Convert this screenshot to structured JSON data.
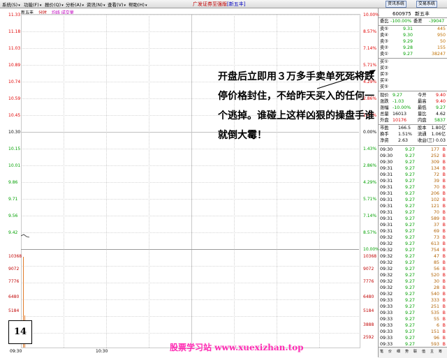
{
  "menu": [
    "系统(S)",
    "功能(F)",
    "报价(Q)",
    "分析(A)",
    "资讯(N)",
    "查看(V)",
    "帮助(H)"
  ],
  "app_title": "广发证券至强版",
  "app_title_sub": "[新五丰]",
  "toolbar_buttons": [
    "资讯系统",
    "交易系统"
  ],
  "chart_tabs": {
    "name": "新五丰",
    "time": "分时",
    "avg": "均线 成交量"
  },
  "price_axis": [
    "11.33",
    "11.18",
    "11.03",
    "10.89",
    "10.74",
    "10.59",
    "10.45",
    "10.30",
    "10.15",
    "10.01",
    "9.86",
    "9.71",
    "9.56",
    "9.42"
  ],
  "pct_axis_up": [
    "10.00%",
    "8.57%",
    "7.14%",
    "5.71%",
    "4.29%",
    "2.86%",
    "1.43%",
    "0.00%"
  ],
  "pct_axis_down": [
    "1.43%",
    "2.86%",
    "4.29%",
    "5.71%",
    "7.14%",
    "8.57%",
    "10.00%"
  ],
  "volume_axis": [
    "10368",
    "9072",
    "7776",
    "6480",
    "5184",
    "3888",
    "2592",
    "1296"
  ],
  "time_labels": [
    "09:30",
    "10:30"
  ],
  "badge": "14",
  "annotation": "开盘后立即用３万多手卖单死死将跌停价格封住，不给昨天买入的任何一个逃掉。谁碰上这样凶狠的操盘手谁就倒大霉！",
  "watermark": "股票学习站   www.xuexizhan.top",
  "stock": {
    "code": "600975",
    "name": "新五丰"
  },
  "commission": {
    "label": "委比",
    "ratio": "-100.00%",
    "diff_label": "委差",
    "diff": "-39047"
  },
  "sell_orders": [
    {
      "label": "卖⑤",
      "price": "9.31",
      "vol": "445"
    },
    {
      "label": "卖④",
      "price": "9.30",
      "vol": "950"
    },
    {
      "label": "卖③",
      "price": "9.29",
      "vol": "50"
    },
    {
      "label": "卖②",
      "price": "9.28",
      "vol": "155"
    },
    {
      "label": "卖①",
      "price": "9.27",
      "vol": "38247"
    }
  ],
  "buy_orders": [
    "买①",
    "买②",
    "买③",
    "买④",
    "买⑤"
  ],
  "quote_rows": [
    {
      "l1": "现价",
      "v1": "9.27",
      "l2": "今开",
      "v2": "9.40"
    },
    {
      "l1": "涨跌",
      "v1": "-1.03",
      "l2": "最高",
      "v2": "9.40"
    },
    {
      "l1": "涨幅",
      "v1": "-10.00%",
      "l2": "最低",
      "v2": "9.27"
    },
    {
      "l1": "总量",
      "v1": "16013",
      "l2": "量比",
      "v2": "4.62"
    },
    {
      "l1": "外盘",
      "v1": "10176",
      "l2": "内盘",
      "v2": "5837"
    }
  ],
  "stats_rows": [
    {
      "l1": "市盈",
      "v1": "166.5",
      "l2": "股本",
      "v2": "1.80亿"
    },
    {
      "l1": "换手",
      "v1": "1.51%",
      "l2": "流通",
      "v2": "1.06亿"
    },
    {
      "l1": "净资",
      "v1": "2.63",
      "l2": "收益(三)",
      "v2": "0.03"
    }
  ],
  "ticks": [
    {
      "t": "09:30",
      "p": "9.27",
      "v": "177",
      "d": "B"
    },
    {
      "t": "09:30",
      "p": "9.27",
      "v": "252",
      "d": "B"
    },
    {
      "t": "09:30",
      "p": "9.27",
      "v": "309",
      "d": "B"
    },
    {
      "t": "09:31",
      "p": "9.27",
      "v": "134",
      "d": "B"
    },
    {
      "t": "09:31",
      "p": "9.27",
      "v": "72",
      "d": "B"
    },
    {
      "t": "09:31",
      "p": "9.27",
      "v": "39",
      "d": "B"
    },
    {
      "t": "09:31",
      "p": "9.27",
      "v": "70",
      "d": "B"
    },
    {
      "t": "09:31",
      "p": "9.27",
      "v": "206",
      "d": "B"
    },
    {
      "t": "09:31",
      "p": "9.27",
      "v": "102",
      "d": "B"
    },
    {
      "t": "09:31",
      "p": "9.27",
      "v": "121",
      "d": "B"
    },
    {
      "t": "09:31",
      "p": "9.27",
      "v": "70",
      "d": "B"
    },
    {
      "t": "09:31",
      "p": "9.27",
      "v": "589",
      "d": "B"
    },
    {
      "t": "09:31",
      "p": "9.27",
      "v": "37",
      "d": "B"
    },
    {
      "t": "09:31",
      "p": "9.27",
      "v": "69",
      "d": "B"
    },
    {
      "t": "09:32",
      "p": "9.27",
      "v": "73",
      "d": "B"
    },
    {
      "t": "09:32",
      "p": "9.27",
      "v": "613",
      "d": "B"
    },
    {
      "t": "09:32",
      "p": "9.27",
      "v": "754",
      "d": "B"
    },
    {
      "t": "09:32",
      "p": "9.27",
      "v": "47",
      "d": "B"
    },
    {
      "t": "09:32",
      "p": "9.27",
      "v": "85",
      "d": "B"
    },
    {
      "t": "09:32",
      "p": "9.27",
      "v": "56",
      "d": "B"
    },
    {
      "t": "09:32",
      "p": "9.27",
      "v": "520",
      "d": "B"
    },
    {
      "t": "09:32",
      "p": "9.27",
      "v": "30",
      "d": "B"
    },
    {
      "t": "09:32",
      "p": "9.27",
      "v": "28",
      "d": "B"
    },
    {
      "t": "09:32",
      "p": "9.27",
      "v": "540",
      "d": "B"
    },
    {
      "t": "09:33",
      "p": "9.27",
      "v": "333",
      "d": "B"
    },
    {
      "t": "09:33",
      "p": "9.27",
      "v": "251",
      "d": "B"
    },
    {
      "t": "09:33",
      "p": "9.27",
      "v": "535",
      "d": "B"
    },
    {
      "t": "09:33",
      "p": "9.27",
      "v": "55",
      "d": "B"
    },
    {
      "t": "09:33",
      "p": "9.27",
      "v": "6",
      "d": "B"
    },
    {
      "t": "09:33",
      "p": "9.27",
      "v": "151",
      "d": "B"
    },
    {
      "t": "09:33",
      "p": "9.27",
      "v": "96",
      "d": "B"
    },
    {
      "t": "09:33",
      "p": "9.27",
      "v": "593",
      "d": "B"
    }
  ],
  "bottom_tabs": [
    "笔",
    "价",
    "细",
    "势",
    "联",
    "值",
    "主",
    "筹"
  ],
  "colors": {
    "up": "#e00000",
    "down": "#00a000",
    "watermark": "#ff2db4",
    "volume": "#e07a2a"
  }
}
